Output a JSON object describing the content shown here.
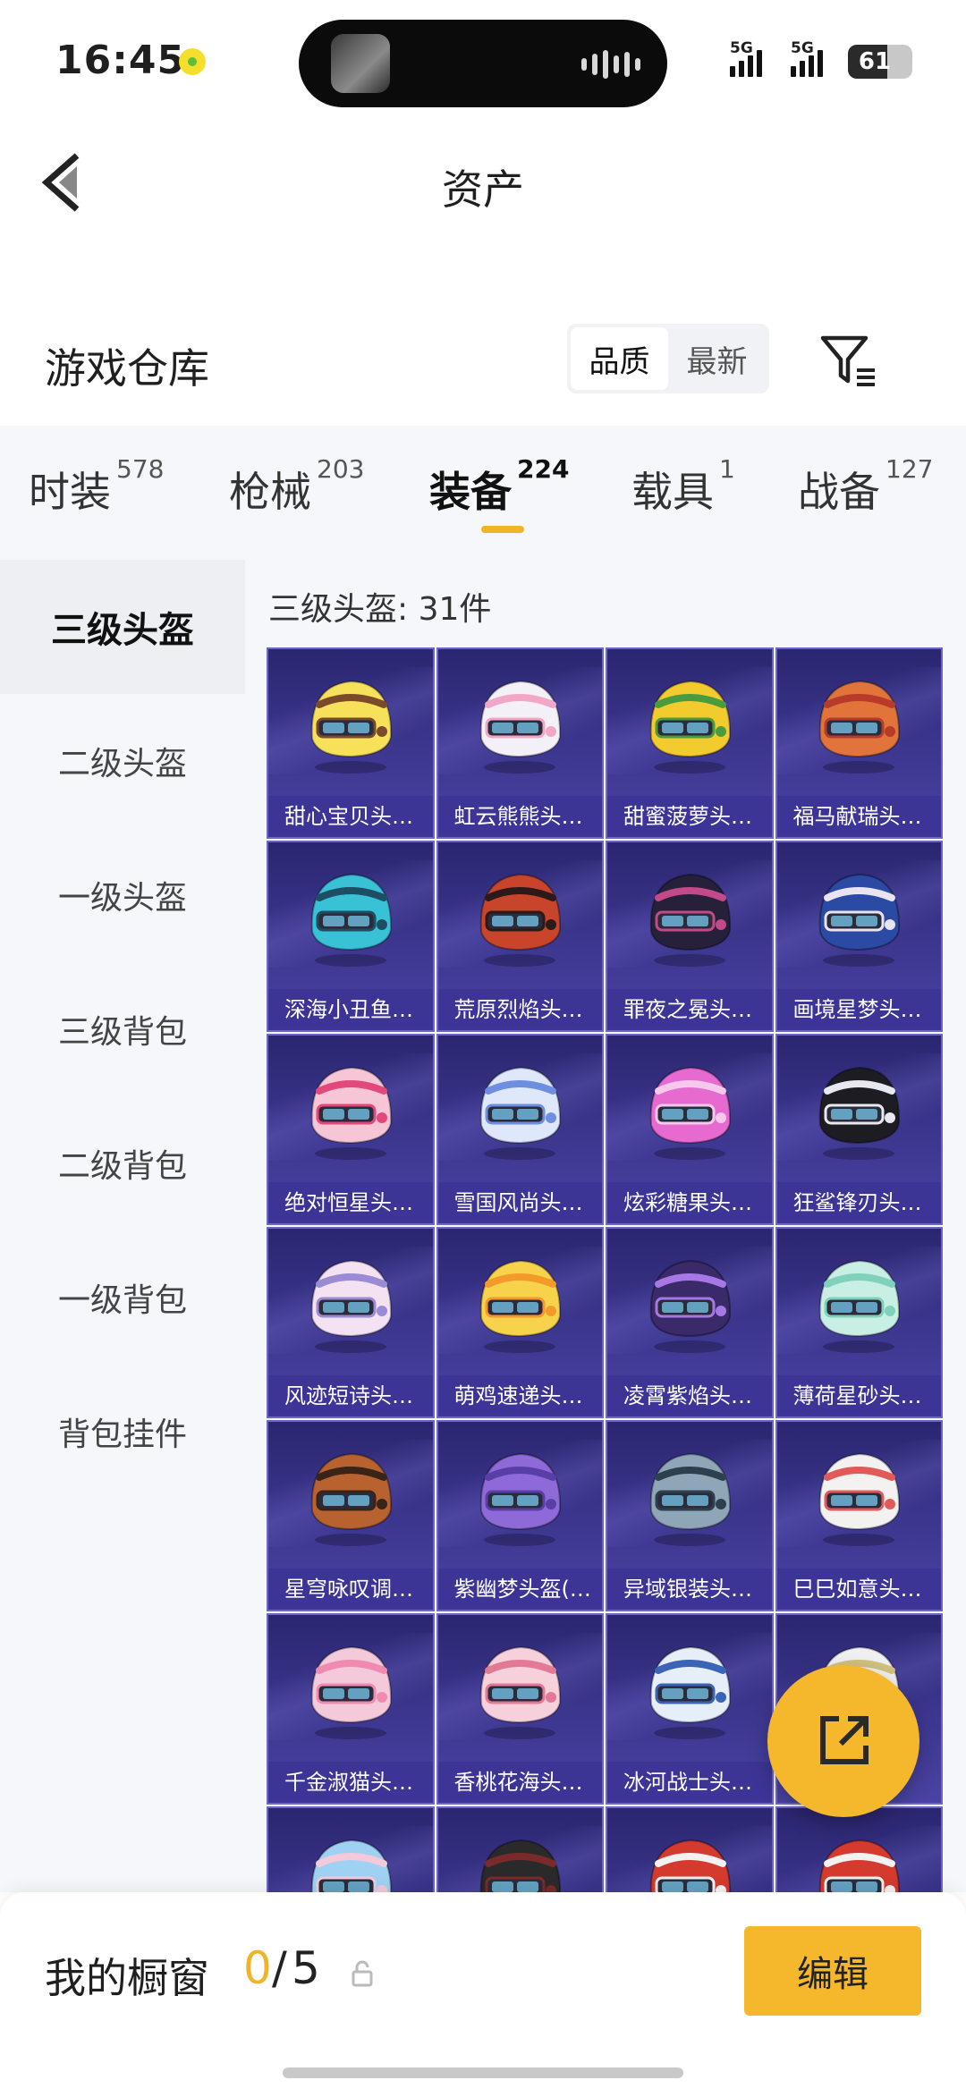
{
  "status_bar": {
    "time": "16:45",
    "sim1": "5G",
    "sim2": "5G",
    "battery": "61"
  },
  "header": {
    "title": "资产"
  },
  "warehouse": {
    "title": "游戏仓库",
    "sort_options": [
      "品质",
      "最新"
    ],
    "active_sort": "品质"
  },
  "tabs": [
    {
      "label": "时装",
      "count": "578"
    },
    {
      "label": "枪械",
      "count": "203"
    },
    {
      "label": "装备",
      "count": "224"
    },
    {
      "label": "载具",
      "count": "1"
    },
    {
      "label": "战备",
      "count": "127"
    }
  ],
  "active_tab": "装备",
  "side_menu": [
    "三级头盔",
    "二级头盔",
    "一级头盔",
    "三级背包",
    "二级背包",
    "一级背包",
    "背包挂件"
  ],
  "active_side": "三级头盔",
  "content": {
    "count_label": "三级头盔: 31件",
    "items": [
      {
        "name": "甜心宝贝头…",
        "colors": [
          "#f7e15b",
          "#7a4a2a"
        ]
      },
      {
        "name": "虹云熊熊头…",
        "colors": [
          "#f3f0f7",
          "#f2a6c8"
        ]
      },
      {
        "name": "甜蜜菠萝头…",
        "colors": [
          "#f2cb2f",
          "#4a9b3d"
        ]
      },
      {
        "name": "福马献瑞头…",
        "colors": [
          "#e0743a",
          "#b83a2a"
        ]
      },
      {
        "name": "深海小丑鱼…",
        "colors": [
          "#39c1d6",
          "#1d4e63"
        ]
      },
      {
        "name": "荒原烈焰头…",
        "colors": [
          "#c8452b",
          "#2b1a18"
        ]
      },
      {
        "name": "罪夜之冕头…",
        "colors": [
          "#26203a",
          "#c24a8a"
        ]
      },
      {
        "name": "画境星梦头…",
        "colors": [
          "#2b4aa3",
          "#e9e3f2"
        ]
      },
      {
        "name": "绝对恒星头…",
        "colors": [
          "#f6c6d6",
          "#e2487a"
        ]
      },
      {
        "name": "雪国风尚头…",
        "colors": [
          "#dfe8fb",
          "#6e8ee0"
        ]
      },
      {
        "name": "炫彩糖果头…",
        "colors": [
          "#e76ad0",
          "#f6c8ec"
        ]
      },
      {
        "name": "狂鲨锋刃头…",
        "colors": [
          "#1c1c22",
          "#e8e8f0"
        ]
      },
      {
        "name": "风迹短诗头…",
        "colors": [
          "#f4e2f2",
          "#9b8ad4"
        ]
      },
      {
        "name": "萌鸡速递头…",
        "colors": [
          "#f6d34a",
          "#f49a2a"
        ]
      },
      {
        "name": "凌霄紫焰头…",
        "colors": [
          "#3a2a6a",
          "#a678e6"
        ]
      },
      {
        "name": "薄荷星砂头…",
        "colors": [
          "#c9efe4",
          "#7fd1bb"
        ]
      },
      {
        "name": "星穹咏叹调…",
        "colors": [
          "#b8622f",
          "#3a2418"
        ]
      },
      {
        "name": "紫幽梦头盔(…",
        "colors": [
          "#8e6ad8",
          "#5a3ea8"
        ]
      },
      {
        "name": "异域银装头…",
        "colors": [
          "#8fa6b8",
          "#2e3f4e"
        ]
      },
      {
        "name": "巳巳如意头…",
        "colors": [
          "#f4f1f1",
          "#e05a5a"
        ]
      },
      {
        "name": "千金淑猫头…",
        "colors": [
          "#f4c9d9",
          "#f08ab0"
        ]
      },
      {
        "name": "香桃花海头…",
        "colors": [
          "#f6d0da",
          "#e37a95"
        ]
      },
      {
        "name": "冰河战士头…",
        "colors": [
          "#e6eef8",
          "#3b64b6"
        ]
      },
      {
        "name": "",
        "colors": [
          "#f0f0f0",
          "#d0c080"
        ]
      },
      {
        "name": "",
        "colors": [
          "#9fd2f2",
          "#f4c9d9"
        ]
      },
      {
        "name": "",
        "colors": [
          "#2a2a2a",
          "#7a2a2a"
        ]
      },
      {
        "name": "",
        "colors": [
          "#d53a2e",
          "#f4f1f1"
        ]
      },
      {
        "name": "",
        "colors": [
          "#d53a2e",
          "#f4f1f1"
        ]
      }
    ]
  },
  "showcase": {
    "label": "我的橱窗",
    "used": "0",
    "separator": "/",
    "total": "5",
    "edit_label": "编辑"
  },
  "colors": {
    "accent": "#f5b82c",
    "card_bg": "#3d3790",
    "card_label_bg": "#3c3496"
  }
}
